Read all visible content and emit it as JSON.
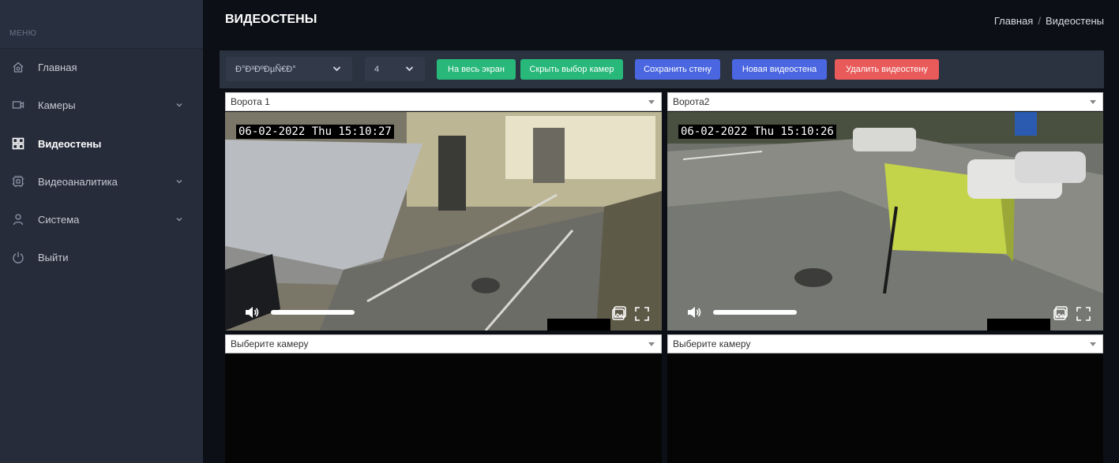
{
  "sidebar": {
    "menu_label": "МЕНЮ",
    "items": [
      {
        "label": "Главная",
        "icon": "home-icon"
      },
      {
        "label": "Камеры",
        "icon": "camera-icon"
      },
      {
        "label": "Видеостены",
        "icon": "grid-icon"
      },
      {
        "label": "Видеоаналитика",
        "icon": "analytics-icon"
      },
      {
        "label": "Система",
        "icon": "user-icon"
      },
      {
        "label": "Выйти",
        "icon": "power-icon"
      }
    ]
  },
  "header": {
    "title": "ВИДЕОСТЕНЫ",
    "breadcrumb_home": "Главная",
    "breadcrumb_sep": "/",
    "breadcrumb_current": "Видеостены"
  },
  "toolbar": {
    "wall_select": "Ð°Ð³ÐºÐµÑ€Ð°",
    "grid_select": "4",
    "fullscreen_label": "На весь экран",
    "hide_cameras_label": "Скрыть выбор камер",
    "save_wall_label": "Сохранить стену",
    "new_wall_label": "Новая видеостена",
    "delete_wall_label": "Удалить видеостену"
  },
  "cells": [
    {
      "camera": "Ворота 1",
      "timestamp": "06-02-2022 Thu 15:10:27"
    },
    {
      "camera": "Ворота2",
      "timestamp": "06-02-2022 Thu 15:10:26"
    },
    {
      "camera": "Выберите камеру"
    },
    {
      "camera": "Выберите камеру"
    }
  ],
  "colors": {
    "sidebar_bg": "#262c3a",
    "green_button": "#27b87a",
    "blue_button": "#4a66e0",
    "red_button": "#e95a5a"
  }
}
